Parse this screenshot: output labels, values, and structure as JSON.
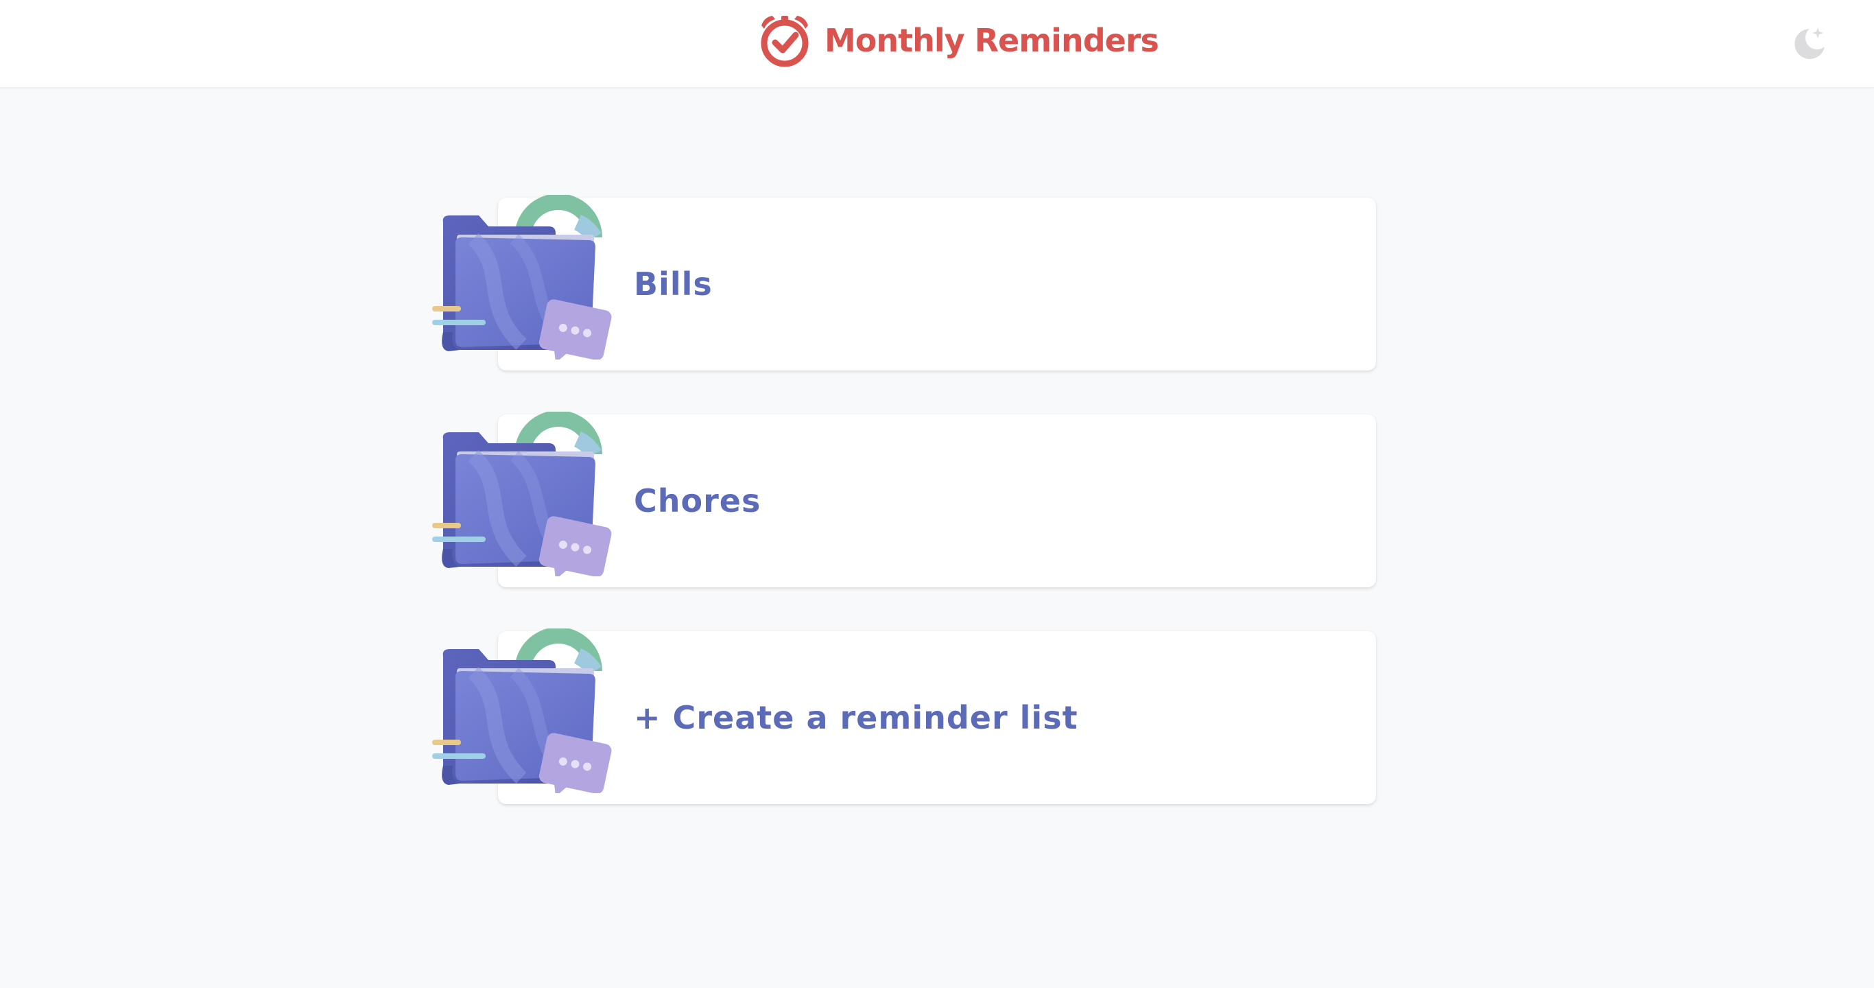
{
  "header": {
    "title": "Monthly Reminders",
    "brand_color": "#d9534f",
    "logo_icon": "alarm-clock-check-icon",
    "theme_toggle_icon": "moon-stars-icon"
  },
  "lists": [
    {
      "label": "Bills",
      "icon": "folder-illustration-icon"
    },
    {
      "label": "Chores",
      "icon": "folder-illustration-icon"
    }
  ],
  "create": {
    "label": "+ Create a reminder list",
    "icon": "folder-illustration-icon"
  },
  "colors": {
    "label": "#5c6bb8",
    "folder": "#6a74c9",
    "background": "#f8f9fa"
  }
}
